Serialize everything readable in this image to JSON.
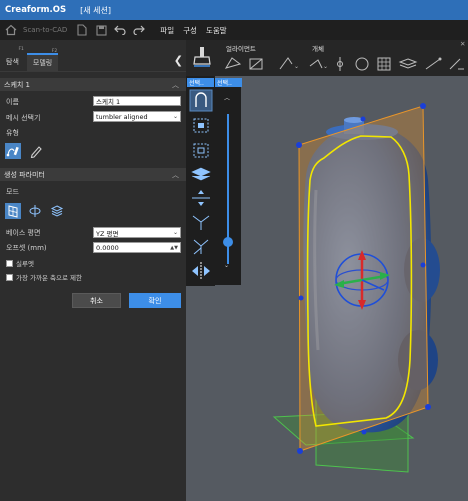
{
  "titlebar": {
    "app_name": "Creaform.OS",
    "session": "[새 세션]"
  },
  "toolbar": {
    "scan_to_cad": "Scan-to-CAD",
    "menu": [
      "파일",
      "구성",
      "도움말"
    ]
  },
  "left_panel": {
    "tabs": [
      {
        "label": "탐색",
        "superscript": "F1",
        "active": false
      },
      {
        "label": "모델링",
        "superscript": "F2",
        "active": true
      }
    ],
    "sketch_section": {
      "title": "스케치 1",
      "name_label": "이름",
      "name_value": "스케치 1",
      "mesh_selector_label": "메시 선택기",
      "mesh_selector_value": "tumbler aligned",
      "type_label": "유형"
    },
    "creation_params": {
      "title": "생성 파라미터",
      "mode_label": "모드",
      "base_plane_label": "베이스 평면",
      "base_plane_value": "YZ 평면",
      "offset_label": "오프셋 (mm)",
      "offset_value": "0.0000",
      "checkbox_silhouette": "실루엣",
      "checkbox_nearest_axis": "가장 가까운 축으로 제한"
    },
    "buttons": {
      "cancel": "취소",
      "ok": "확인"
    }
  },
  "viewport": {
    "align_label": "얼라이먼트",
    "entity_label": "개체",
    "select_label_1": "선택..",
    "select_label_2": "선택..",
    "colors": {
      "accent": "#3d8ee8",
      "plane_fill": "#e8952a",
      "section_outline": "#f2e600",
      "mesh": "#3a66b5",
      "ground_plane": "#4ec24e"
    }
  }
}
